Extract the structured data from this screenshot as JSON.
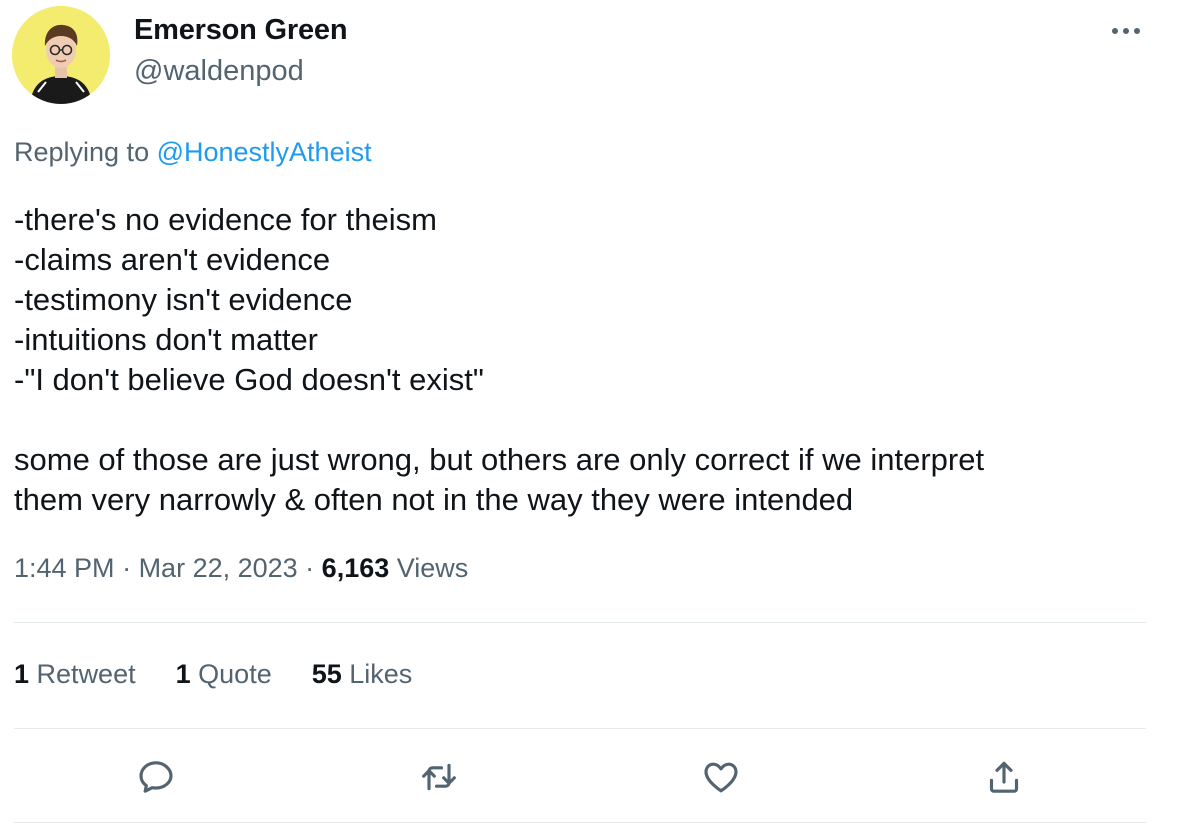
{
  "author": {
    "display_name": "Emerson Green",
    "handle": "@waldenpod",
    "avatar_icon": "avatar-photo-icon"
  },
  "reply": {
    "prefix": "Replying to ",
    "mention": "@HonestlyAtheist"
  },
  "body": {
    "lines": [
      "-there's no evidence for theism",
      "-claims aren't evidence",
      "-testimony isn't evidence",
      "-intuitions don't matter",
      "-\"I don't believe God doesn't exist\""
    ],
    "paragraph": [
      "some of those are just wrong, but others are only correct if we interpret",
      "them very narrowly & often not in the way they were intended"
    ]
  },
  "meta": {
    "time": "1:44 PM",
    "date": "Mar 22, 2023",
    "separator": " · ",
    "views_count": "6,163",
    "views_label": "Views"
  },
  "stats": {
    "retweets_count": "1",
    "retweets_label": "Retweet",
    "quotes_count": "1",
    "quotes_label": "Quote",
    "likes_count": "55",
    "likes_label": "Likes"
  },
  "actions": {
    "reply_icon": "reply-icon",
    "retweet_icon": "retweet-icon",
    "like_icon": "like-icon",
    "share_icon": "share-icon"
  },
  "colors": {
    "text": "#0f1419",
    "secondary": "#536471",
    "link": "#1d9bf0",
    "divider": "#e6ebee",
    "avatar_bg": "#f3ec6e"
  }
}
